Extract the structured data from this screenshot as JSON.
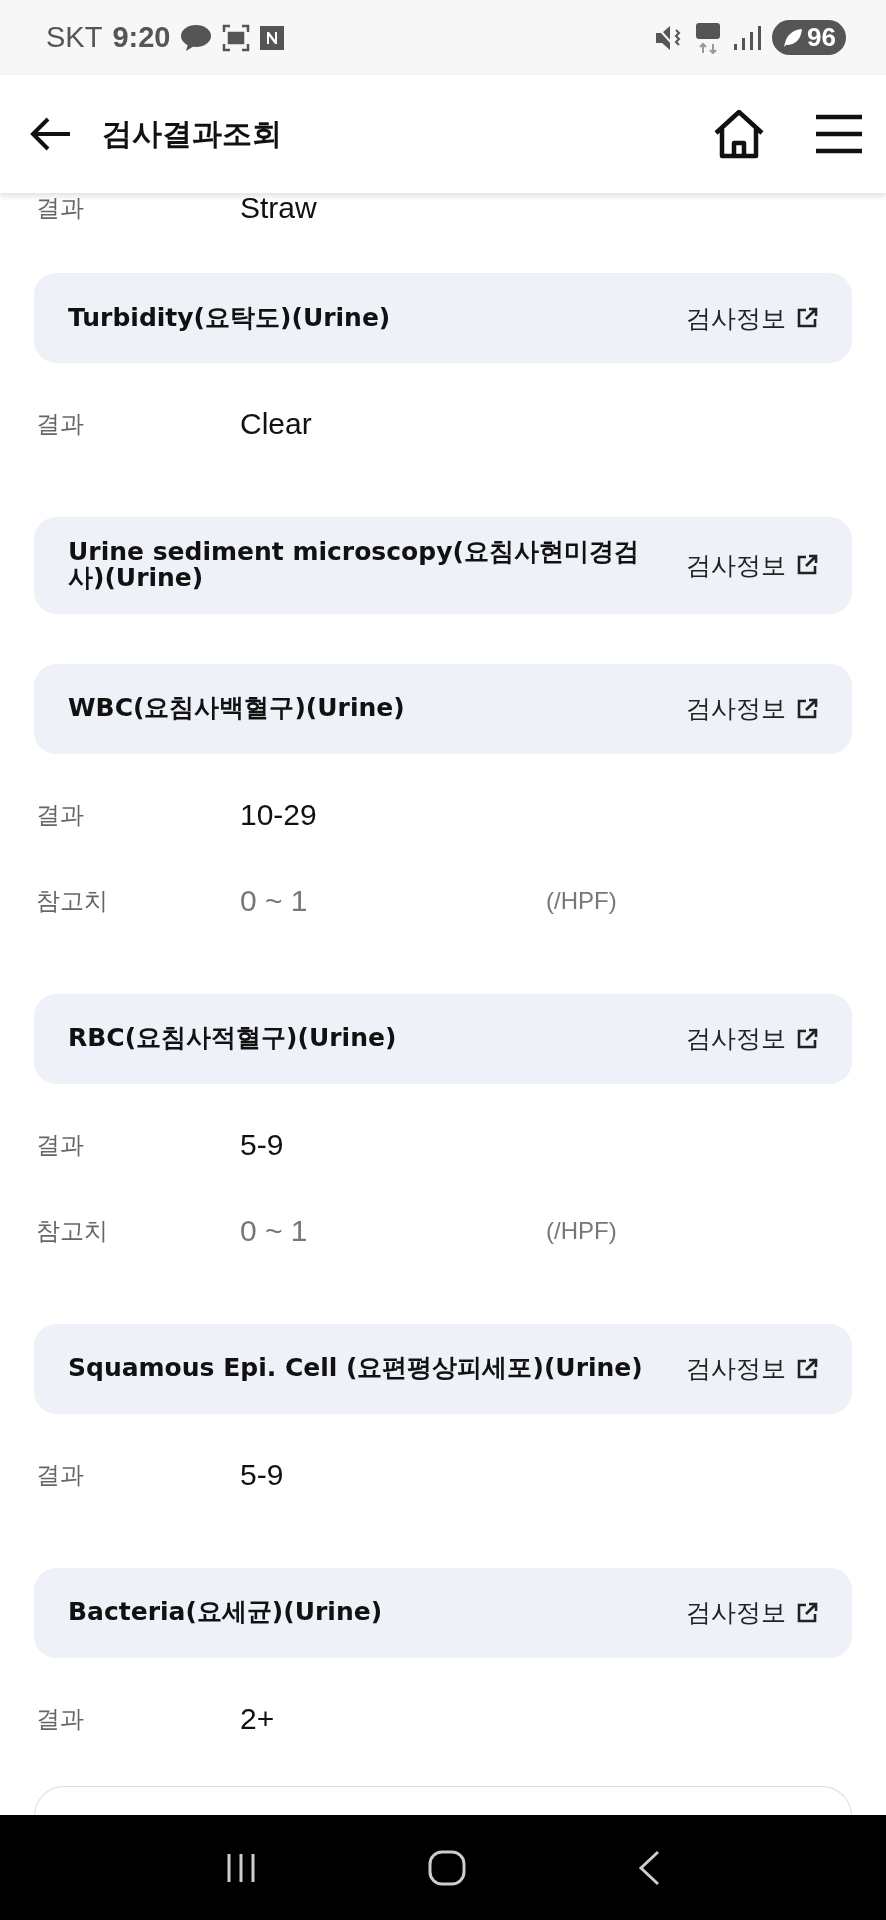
{
  "status_bar": {
    "carrier": "SKT",
    "time": "9:20",
    "battery": "96"
  },
  "header": {
    "title": "검사결과조회"
  },
  "top_rows": [
    {
      "label": "결과",
      "value": "Straw"
    }
  ],
  "tests": [
    {
      "name": "Turbidity(요탁도)(Urine)",
      "link": "검사정보",
      "rows": [
        {
          "label": "결과",
          "value": "Clear"
        }
      ]
    },
    {
      "name": "Urine sediment microscopy(요침사현미경검사)(Urine)",
      "link": "검사정보"
    },
    {
      "name": "WBC(요침사백혈구)(Urine)",
      "link": "검사정보",
      "rows": [
        {
          "label": "결과",
          "value": "10-29"
        },
        {
          "label": "참고치",
          "value": "0 ~ 1",
          "unit": "(/HPF)",
          "kind": "reference"
        }
      ]
    },
    {
      "name": "RBC(요침사적혈구)(Urine)",
      "link": "검사정보",
      "rows": [
        {
          "label": "결과",
          "value": "5-9"
        },
        {
          "label": "참고치",
          "value": "0 ~ 1",
          "unit": "(/HPF)",
          "kind": "reference"
        }
      ]
    },
    {
      "name": "Squamous Epi. Cell (요편평상피세포)(Urine)",
      "link": "검사정보",
      "rows": [
        {
          "label": "결과",
          "value": "5-9"
        }
      ]
    },
    {
      "name": "Bacteria(요세균)(Urine)",
      "link": "검사정보",
      "rows": [
        {
          "label": "결과",
          "value": "2+"
        }
      ]
    }
  ]
}
